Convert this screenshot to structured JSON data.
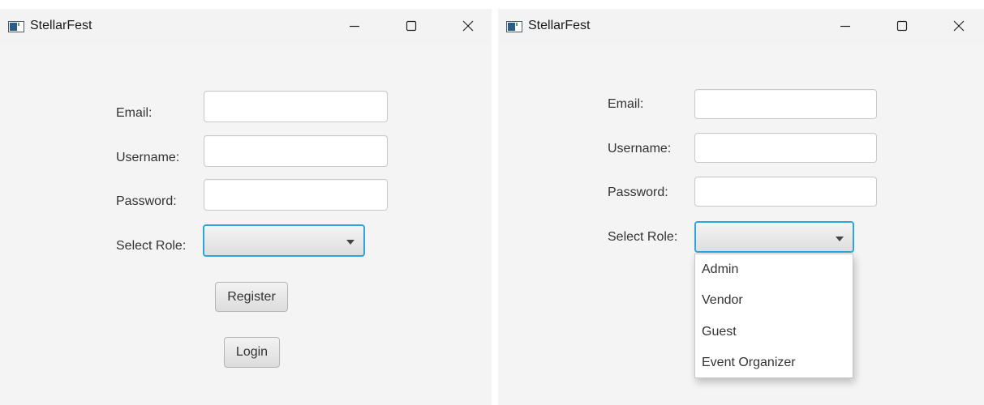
{
  "window_title": "StellarFest",
  "form": {
    "email_label": "Email:",
    "username_label": "Username:",
    "password_label": "Password:",
    "role_label": "Select Role:",
    "email_value": "",
    "username_value": "",
    "password_value": ""
  },
  "buttons": {
    "register": "Register",
    "login": "Login"
  },
  "role_options": [
    "Admin",
    "Vendor",
    "Guest",
    "Event Organizer"
  ],
  "icons": {
    "app": "app-window-icon",
    "minimize": "minimize-icon",
    "maximize": "maximize-icon",
    "close": "close-icon"
  },
  "colors": {
    "focus": "#2ea4df",
    "background": "#f4f4f4"
  }
}
